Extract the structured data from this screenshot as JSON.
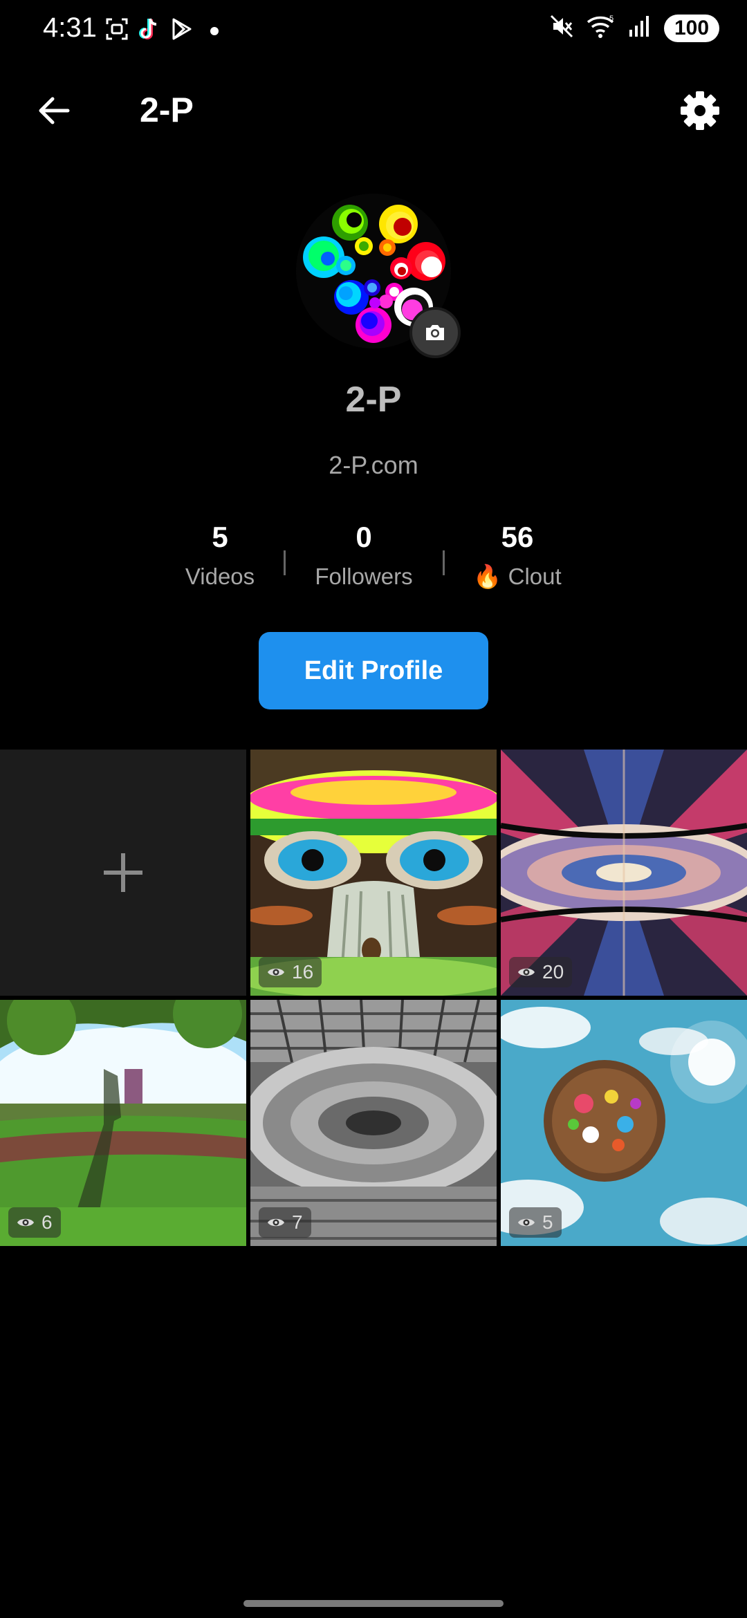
{
  "status_bar": {
    "time": "4:31",
    "battery": "100",
    "left_icons": [
      "screenshot-icon",
      "tiktok-icon",
      "play-store-icon",
      "notification-dot-icon"
    ],
    "right_icons": [
      "mute-icon",
      "wifi-icon",
      "signal-icon"
    ]
  },
  "header": {
    "title": "2-P",
    "back_icon": "arrow-left-icon",
    "settings_icon": "gear-icon"
  },
  "profile": {
    "name": "2-P",
    "link": "2-P.com",
    "camera_icon": "camera-icon"
  },
  "stats": [
    {
      "value": "5",
      "label": "Videos"
    },
    {
      "value": "0",
      "label": "Followers"
    },
    {
      "value": "56",
      "label": "Clout",
      "icon": "🔥"
    }
  ],
  "edit_button": "Edit Profile",
  "colors": {
    "accent": "#1e90ee",
    "background": "#000000"
  },
  "grid": {
    "add_tile_icon": "plus-icon",
    "videos": [
      {
        "views": "16",
        "thumbnail": "psychedelic-mushroom"
      },
      {
        "views": "20",
        "thumbnail": "kaleidoscope"
      },
      {
        "views": "6",
        "thumbnail": "field-panorama"
      },
      {
        "views": "7",
        "thumbnail": "grayscale-tunnel"
      },
      {
        "views": "5",
        "thumbnail": "tiny-planet-sky"
      }
    ]
  }
}
